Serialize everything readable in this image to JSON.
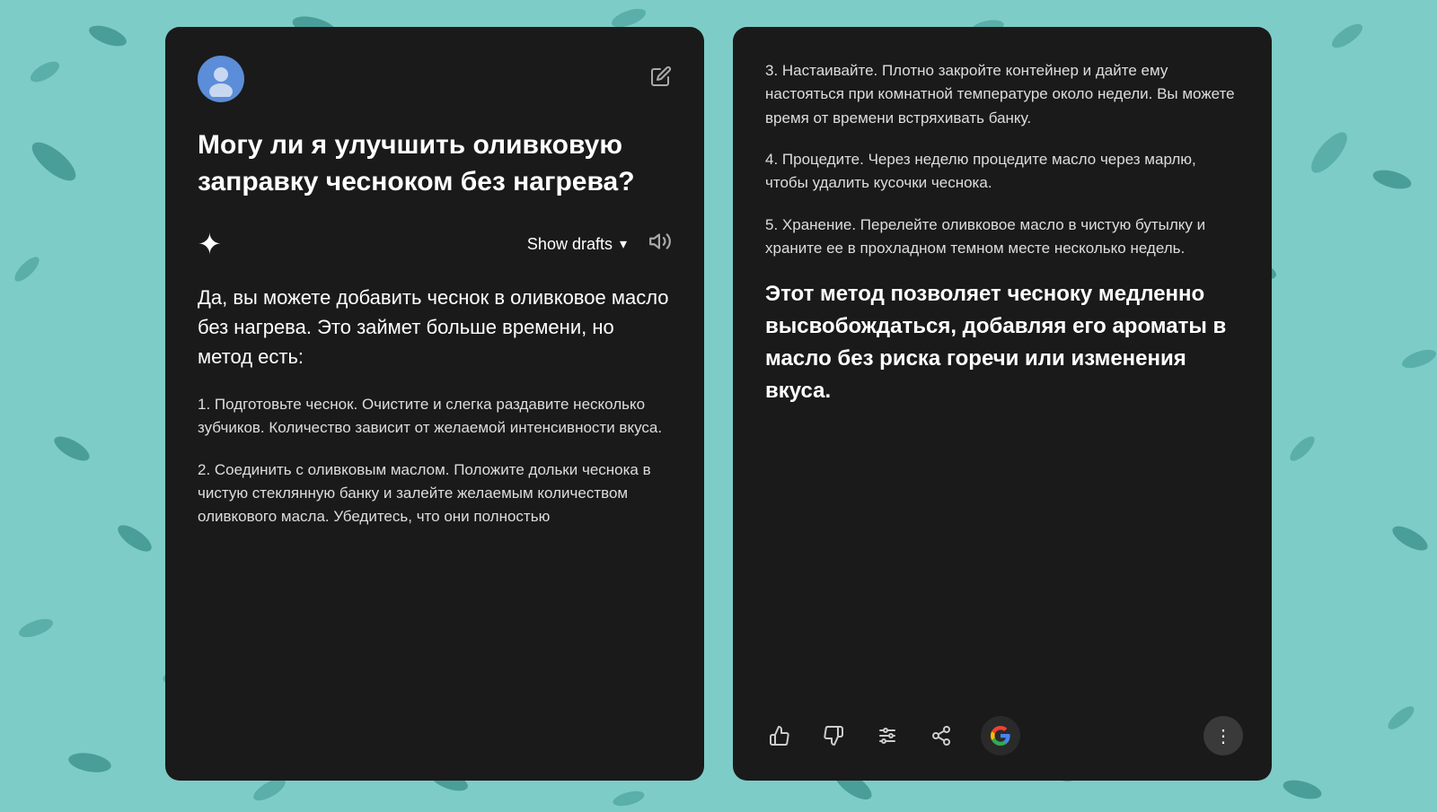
{
  "background": {
    "color": "#7eccc8"
  },
  "left_card": {
    "question": "Могу ли я улучшить оливковую заправку чесноком без нагрева?",
    "show_drafts_label": "Show drafts",
    "answer_intro": "Да, вы можете добавить чеснок в оливковое масло без нагрева. Это займет больше времени, но метод есть:",
    "step1": "1. Подготовьте чеснок. Очистите и слегка раздавите несколько зубчиков. Количество зависит от желаемой интенсивности вкуса.",
    "step2": "2. Соединить с оливковым маслом. Положите дольки чеснока в чистую стеклянную банку и залейте желаемым количеством оливкового масла. Убедитесь, что они полностью"
  },
  "right_card": {
    "step3": "3. Настаивайте. Плотно закройте контейнер и дайте ему настояться при комнатной температуре около недели. Вы можете время от времени встряхивать банку.",
    "step4": "4. Процедите. Через неделю процедите масло через марлю, чтобы удалить кусочки чеснока.",
    "step5": "5. Хранение. Перелейте оливковое масло в чистую бутылку и храните ее в прохладном темном месте несколько недель.",
    "conclusion": "Этот метод позволяет чесноку медленно высвобождаться, добавляя его ароматы в масло без риска горечи или изменения вкуса.",
    "footer_icons": {
      "thumbs_up": "👍",
      "thumbs_down": "👎",
      "settings": "⚙",
      "share": "⬆",
      "more": "⋮"
    }
  }
}
